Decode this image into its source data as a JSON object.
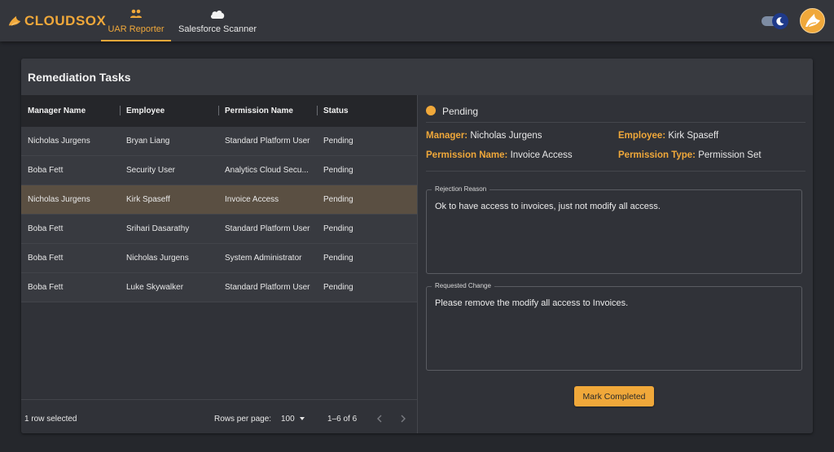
{
  "brand": {
    "logo_text": "CLOUDSOX",
    "accent": "#f0a83a"
  },
  "nav": {
    "tabs": [
      {
        "label": "UAR Reporter",
        "icon": "users-icon",
        "active": true
      },
      {
        "label": "Salesforce Scanner",
        "icon": "cloud-icon",
        "active": false
      }
    ]
  },
  "theme_toggle": {
    "state": "dark",
    "icon": "moon-icon"
  },
  "card": {
    "title": "Remediation Tasks"
  },
  "table": {
    "columns": [
      "Manager Name",
      "Employee",
      "Permission Name",
      "Status"
    ],
    "rows": [
      {
        "manager": "Nicholas Jurgens",
        "employee": "Bryan Liang",
        "permission": "Standard Platform User",
        "status": "Pending"
      },
      {
        "manager": "Boba Fett",
        "employee": "Security User",
        "permission": "Analytics Cloud Secu...",
        "status": "Pending"
      },
      {
        "manager": "Nicholas Jurgens",
        "employee": "Kirk Spaseff",
        "permission": "Invoice Access",
        "status": "Pending"
      },
      {
        "manager": "Boba Fett",
        "employee": "Srihari Dasarathy",
        "permission": "Standard Platform User",
        "status": "Pending"
      },
      {
        "manager": "Boba Fett",
        "employee": "Nicholas Jurgens",
        "permission": "System Administrator",
        "status": "Pending"
      },
      {
        "manager": "Boba Fett",
        "employee": "Luke Skywalker",
        "permission": "Standard Platform User",
        "status": "Pending"
      }
    ],
    "footer": {
      "selected_text": "1 row selected",
      "rows_per_page_label": "Rows per page:",
      "rows_per_page_value": "100",
      "range_text": "1–6 of 6"
    }
  },
  "detail": {
    "status": "Pending",
    "manager_label": "Manager:",
    "manager_value": "Nicholas Jurgens",
    "employee_label": "Employee:",
    "employee_value": "Kirk Spaseff",
    "permission_name_label": "Permission Name:",
    "permission_name_value": "Invoice Access",
    "permission_type_label": "Permission Type:",
    "permission_type_value": "Permission Set",
    "rejection_reason_label": "Rejection Reason",
    "rejection_reason_value": "Ok to have access to invoices, just not modify all access.",
    "requested_change_label": "Requested Change",
    "requested_change_value": "Please remove the modify all access to Invoices.",
    "action_label": "Mark Completed"
  }
}
